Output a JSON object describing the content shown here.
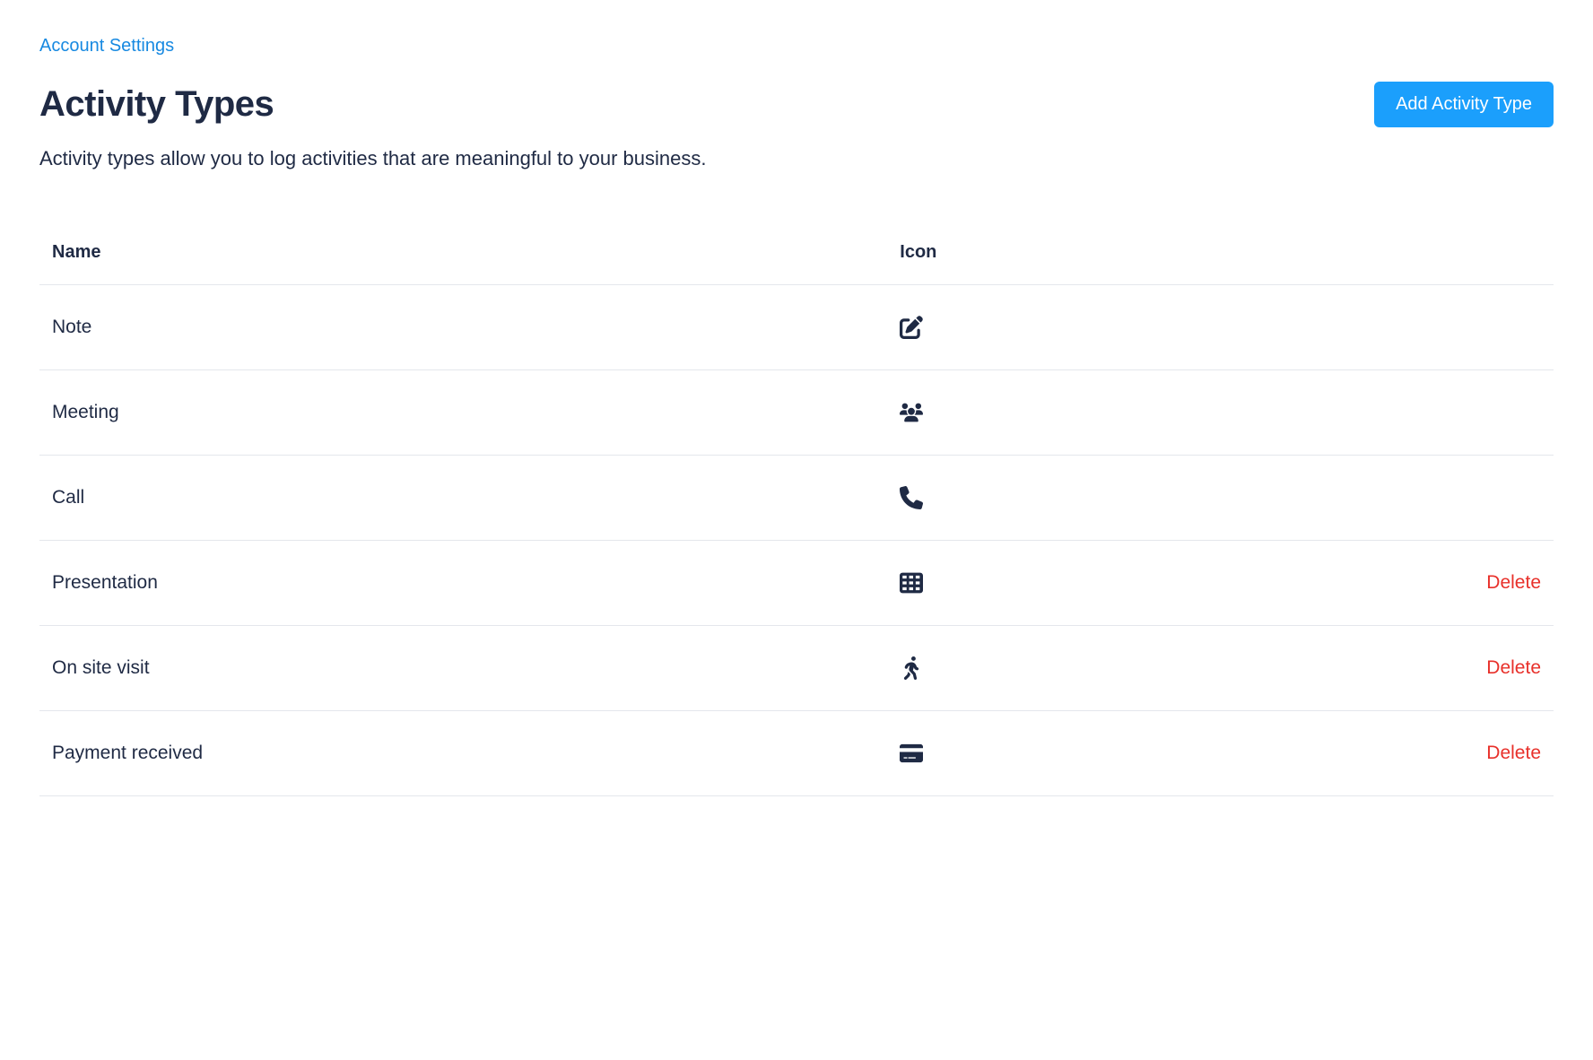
{
  "breadcrumb": "Account Settings",
  "header": {
    "title": "Activity Types",
    "add_button": "Add Activity Type"
  },
  "description": "Activity types allow you to log activities that are meaningful to your business.",
  "table": {
    "headers": {
      "name": "Name",
      "icon": "Icon"
    },
    "delete_label": "Delete",
    "rows": [
      {
        "name": "Note",
        "icon": "pen-to-square-icon",
        "deletable": false
      },
      {
        "name": "Meeting",
        "icon": "users-icon",
        "deletable": false
      },
      {
        "name": "Call",
        "icon": "phone-icon",
        "deletable": false
      },
      {
        "name": "Presentation",
        "icon": "table-cells-icon",
        "deletable": true
      },
      {
        "name": "On site visit",
        "icon": "person-walking-icon",
        "deletable": true
      },
      {
        "name": "Payment received",
        "icon": "credit-card-icon",
        "deletable": true
      }
    ]
  }
}
